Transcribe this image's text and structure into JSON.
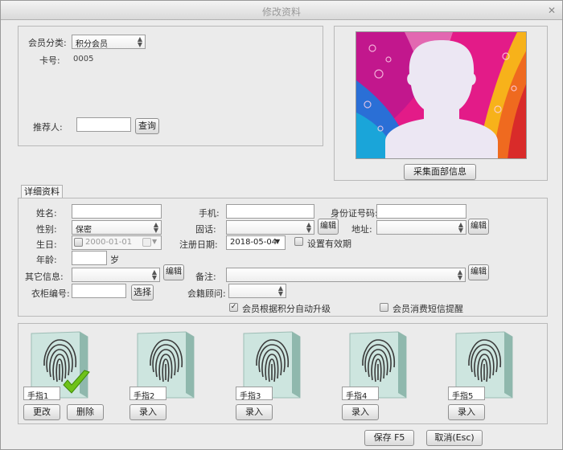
{
  "window": {
    "title": "修改资料",
    "close_glyph": "✕"
  },
  "member": {
    "category_label": "会员分类:",
    "category_value": "积分会员",
    "card_label": "卡号:",
    "card_value": "0005",
    "referrer_label": "推荐人:",
    "referrer_value": "",
    "query_button": "查询"
  },
  "photo": {
    "capture_button": "采集面部信息"
  },
  "details": {
    "tab_label": "详细资料",
    "name_label": "姓名:",
    "name_value": "",
    "mobile_label": "手机:",
    "mobile_value": "",
    "id_label": "身份证号码:",
    "id_value": "",
    "gender_label": "性别:",
    "gender_value": "保密",
    "phone_label": "固话:",
    "phone_value": "",
    "address_label": "地址:",
    "address_value": "",
    "birthday_label": "生日:",
    "birthday_value": "2000-01-01",
    "regdate_label": "注册日期:",
    "regdate_value": "2018-05-04",
    "validity_label": "设置有效期",
    "age_label": "年龄:",
    "age_value": "",
    "age_unit": "岁",
    "other_label": "其它信息:",
    "other_value": "",
    "remark_label": "备注:",
    "remark_value": "",
    "locker_label": "衣柜编号:",
    "locker_value": "",
    "select_button": "选择",
    "advisor_label": "会籍顾问:",
    "advisor_value": "",
    "edit_button": "编辑",
    "auto_upgrade_label": "会员根据积分自动升级",
    "sms_label": "会员消费短信提醒"
  },
  "fingers": [
    {
      "label": "手指1",
      "enrolled": true,
      "buttons": [
        "更改",
        "删除"
      ]
    },
    {
      "label": "手指2",
      "enrolled": false,
      "buttons": [
        "录入"
      ]
    },
    {
      "label": "手指3",
      "enrolled": false,
      "buttons": [
        "录入"
      ]
    },
    {
      "label": "手指4",
      "enrolled": false,
      "buttons": [
        "录入"
      ]
    },
    {
      "label": "手指5",
      "enrolled": false,
      "buttons": [
        "录入"
      ]
    }
  ],
  "footer": {
    "save_button": "保存 F5",
    "cancel_button": "取消(Esc)"
  },
  "colors": {
    "check_green": "#6ec21a",
    "fingerprint": "#3a3a3a",
    "glass": "#cfe7e2"
  }
}
